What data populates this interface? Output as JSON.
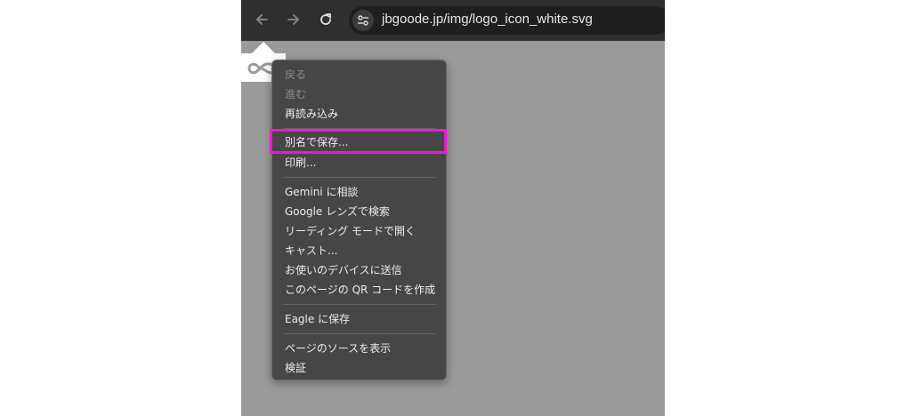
{
  "browser": {
    "url": "jbgoode.jp/img/logo_icon_white.svg",
    "back_icon": "arrow-left-icon",
    "forward_icon": "arrow-right-icon",
    "reload_icon": "reload-icon",
    "site_info_icon": "tune-icon"
  },
  "context_menu": {
    "back": "戻る",
    "forward": "進む",
    "reload": "再読み込み",
    "save_as": "別名で保存...",
    "print": "印刷...",
    "gemini": "Gemini に相談",
    "google_lens": "Google レンズで検索",
    "reading_mode": "リーディング モードで開く",
    "cast": "キャスト...",
    "send_to_devices": "お使いのデバイスに送信",
    "qr_code": "このページの QR コードを作成",
    "eagle": "Eagle に保存",
    "view_source": "ページのソースを表示",
    "inspect": "検証"
  },
  "colors": {
    "highlight": "#e81bd3",
    "menu_bg": "#464646",
    "page_bg": "#9a9a9a",
    "toolbar_bg": "#2f2f2f"
  }
}
